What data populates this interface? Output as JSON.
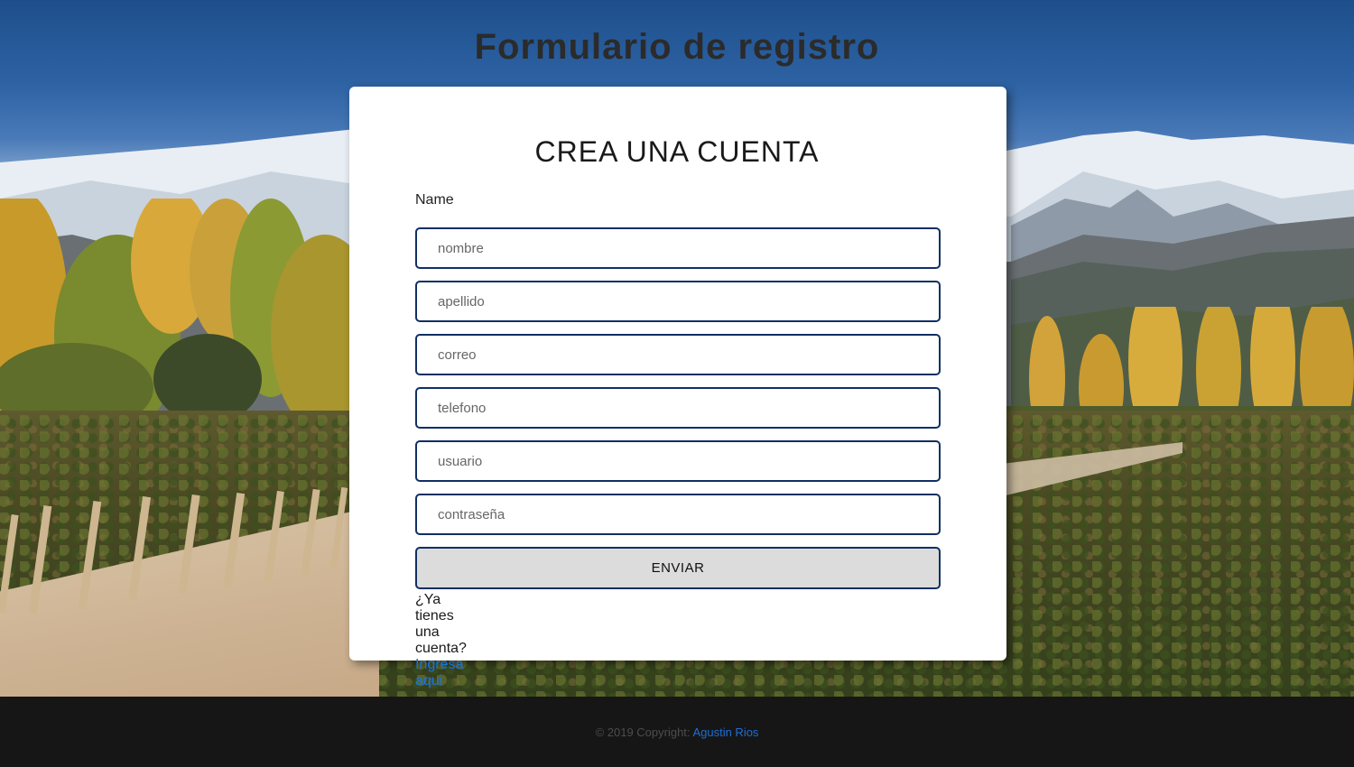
{
  "page": {
    "title": "Formulario de registro"
  },
  "form": {
    "heading": "CREA UNA CUENTA",
    "name_label": "Name",
    "fields": {
      "nombre": "nombre",
      "apellido": "apellido",
      "correo": "correo",
      "telefono": "telefono",
      "usuario": "usuario",
      "contrasena": "contraseña"
    },
    "submit_label": "ENVIAR",
    "login_prompt": "¿Ya tienes una cuenta?",
    "login_link": "Ingresa aqui"
  },
  "footer": {
    "copyright": "© 2019 Copyright:",
    "author": "Agustin Rios"
  },
  "colors": {
    "input_border": "#0f2f63",
    "link": "#1774e0",
    "footer_bg": "#161616",
    "button_bg": "#dcdcdc"
  }
}
